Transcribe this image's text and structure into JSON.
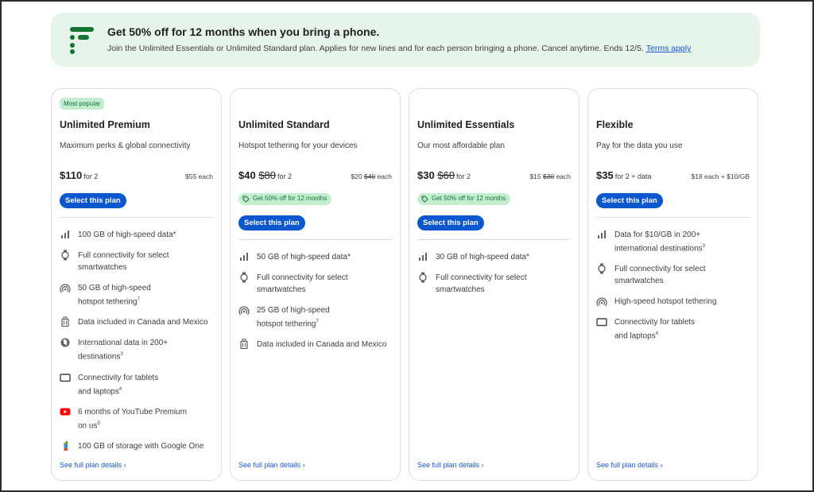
{
  "banner": {
    "title": "Get 50% off for 12 months when you bring a phone.",
    "subtitle": "Join the Unlimited Essentials or Unlimited Standard plan. Applies for new lines and for each person bringing a phone. Cancel anytime. Ends 12/5.",
    "terms_link": "Terms apply",
    "logo_icon": "google-fi-logo"
  },
  "colors": {
    "banner_bg": "#e6f4ea",
    "accent_blue": "#0b57d0",
    "chip_green_bg": "#c4eed0",
    "chip_green_text": "#137333"
  },
  "plans": [
    {
      "badge": "Most popular",
      "name": "Unlimited Premium",
      "description": "Maximum perks & global connectivity",
      "price": "$110",
      "price_old": "",
      "price_for": "for 2",
      "each_price": "$55",
      "each_old": "",
      "each_label": "each",
      "promo": "",
      "select_label": "Select this plan",
      "features": [
        {
          "icon": "signal-bars-icon",
          "lines": [
            "100 GB of high-speed data*"
          ],
          "sup": ""
        },
        {
          "icon": "smartwatch-icon",
          "lines": [
            "Full connectivity for select",
            "smartwatches"
          ],
          "sup": ""
        },
        {
          "icon": "hotspot-icon",
          "lines": [
            "50 GB of high-speed",
            "hotspot tethering"
          ],
          "sup": "7"
        },
        {
          "icon": "luggage-icon",
          "lines": [
            "Data included in Canada and Mexico"
          ],
          "sup": ""
        },
        {
          "icon": "globe-icon",
          "lines": [
            "International data in 200+",
            "destinations"
          ],
          "sup": "3"
        },
        {
          "icon": "tablet-icon",
          "lines": [
            "Connectivity for tablets",
            "and laptops"
          ],
          "sup": "4"
        },
        {
          "icon": "youtube-icon",
          "lines": [
            "6 months of YouTube Premium",
            "on us"
          ],
          "sup": "5"
        },
        {
          "icon": "google-one-icon",
          "lines": [
            "100 GB of storage with Google One"
          ],
          "sup": ""
        }
      ],
      "details_link": "See full plan details"
    },
    {
      "badge": "",
      "name": "Unlimited Standard",
      "description": "Hotspot tethering for your devices",
      "price": "$40",
      "price_old": "$80",
      "price_for": "for 2",
      "each_price": "$20",
      "each_old": "$40",
      "each_label": "each",
      "promo": "Get 50% off for 12 months",
      "select_label": "Select this plan",
      "features": [
        {
          "icon": "signal-bars-icon",
          "lines": [
            "50 GB of high-speed data*"
          ],
          "sup": ""
        },
        {
          "icon": "smartwatch-icon",
          "lines": [
            "Full connectivity for select",
            "smartwatches"
          ],
          "sup": ""
        },
        {
          "icon": "hotspot-icon",
          "lines": [
            "25 GB of high-speed",
            "hotspot tethering"
          ],
          "sup": "7"
        },
        {
          "icon": "luggage-icon",
          "lines": [
            "Data included in Canada and Mexico"
          ],
          "sup": ""
        }
      ],
      "details_link": "See full plan details"
    },
    {
      "badge": "",
      "name": "Unlimited Essentials",
      "description": "Our most affordable plan",
      "price": "$30",
      "price_old": "$60",
      "price_for": "for 2",
      "each_price": "$15",
      "each_old": "$30",
      "each_label": "each",
      "promo": "Get 50% off for 12 months",
      "select_label": "Select this plan",
      "features": [
        {
          "icon": "signal-bars-icon",
          "lines": [
            "30 GB of high-speed data*"
          ],
          "sup": ""
        },
        {
          "icon": "smartwatch-icon",
          "lines": [
            "Full connectivity for select",
            "smartwatches"
          ],
          "sup": ""
        }
      ],
      "details_link": "See full plan details"
    },
    {
      "badge": "",
      "name": "Flexible",
      "description": "Pay for the data you use",
      "price": "$35",
      "price_old": "",
      "price_for": "for 2 + data",
      "each_price": "$18",
      "each_old": "",
      "each_label": "each + $10/GB",
      "promo": "",
      "select_label": "Select this plan",
      "features": [
        {
          "icon": "signal-bars-icon",
          "lines": [
            "Data for $10/GB in 200+",
            "international destinations"
          ],
          "sup": "3"
        },
        {
          "icon": "smartwatch-icon",
          "lines": [
            "Full connectivity for select",
            "smartwatches"
          ],
          "sup": ""
        },
        {
          "icon": "hotspot-icon",
          "lines": [
            "High-speed hotspot tethering"
          ],
          "sup": ""
        },
        {
          "icon": "tablet-icon",
          "lines": [
            "Connectivity for tablets",
            "and laptops"
          ],
          "sup": "4"
        }
      ],
      "details_link": "See full plan details"
    }
  ]
}
